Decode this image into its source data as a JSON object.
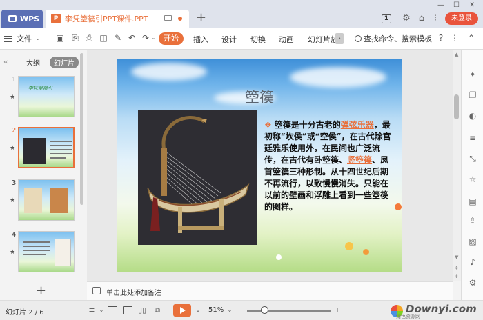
{
  "titlebar": {
    "wps_label": "WPS",
    "document_tab": "李凭箜篌引PPT课件.PPT",
    "new_tab": "+",
    "badge": "1",
    "login_label": "未登录",
    "accent": "#e9703b"
  },
  "toolbar": {
    "file_label": "文件",
    "tabs": [
      "开始",
      "插入",
      "设计",
      "切换",
      "动画",
      "幻灯片放"
    ],
    "search_label": "查找命令、搜索模板",
    "help": "?"
  },
  "left_panel": {
    "collapse": "«",
    "tab_outline": "大纲",
    "tab_slides": "幻灯片",
    "thumbnails": [
      {
        "num": "1",
        "title": "李凭箜篌引"
      },
      {
        "num": "2"
      },
      {
        "num": "3"
      },
      {
        "num": "4"
      }
    ],
    "add": "+"
  },
  "slide": {
    "title": "箜篌",
    "body": {
      "p1": "箜篌是十分古老的",
      "link1": "弹弦乐器",
      "p2": "，最初称“坎侯”或“空侯”，在古代除宫廷雅乐使用外，在民间也广泛流传，在古代有卧箜篌、",
      "link2": "竖箜篌",
      "p3": "、凤首箜篌三种形制。从十四世纪后期不再流行，以致慢慢消失。只能在以前的壁画和浮雕上看到一些箜篌的图样。"
    }
  },
  "notes": {
    "placeholder": "单击此处添加备注"
  },
  "statusbar": {
    "slide_indicator": "幻灯片 2 / 6",
    "zoom": "51%",
    "zoom_out": "−",
    "zoom_in": "+",
    "zoom_level": 0.21
  },
  "watermark": {
    "site": "Downyi.com",
    "sub": "绿色资源网"
  }
}
